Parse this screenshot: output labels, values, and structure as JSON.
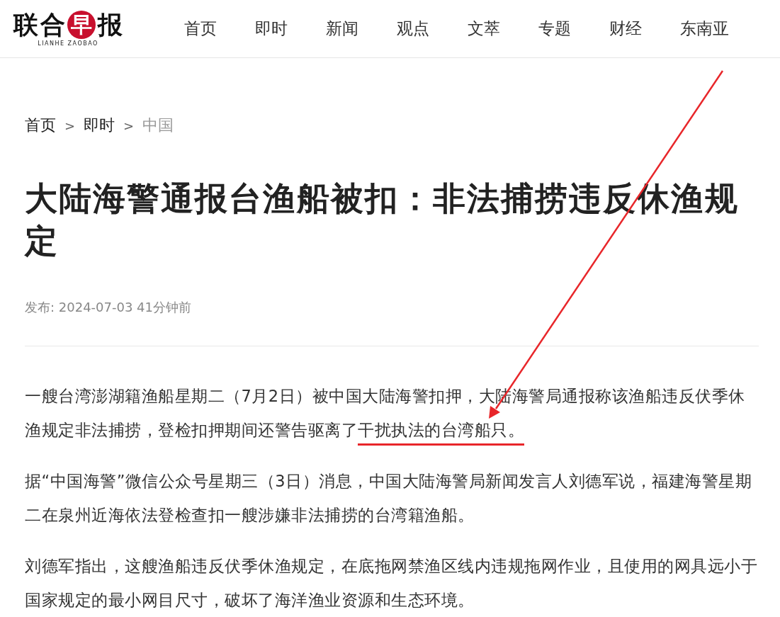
{
  "header": {
    "logo": {
      "chars": [
        {
          "text": "联",
          "kind": "plain"
        },
        {
          "text": "合",
          "kind": "plain"
        },
        {
          "text": "早",
          "kind": "circle"
        },
        {
          "text": "报",
          "kind": "plain"
        }
      ],
      "subtitle": "LIANHE ZAOBAO"
    },
    "nav": [
      {
        "label": "首页"
      },
      {
        "label": "即时"
      },
      {
        "label": "新闻"
      },
      {
        "label": "观点"
      },
      {
        "label": "文萃"
      },
      {
        "label": "专题"
      },
      {
        "label": "财经"
      },
      {
        "label": "东南亚"
      }
    ]
  },
  "breadcrumb": {
    "separator": ">",
    "items": [
      {
        "label": "首页",
        "current": false
      },
      {
        "label": "即时",
        "current": false
      },
      {
        "label": "中国",
        "current": true
      }
    ]
  },
  "article": {
    "title": "大陆海警通报台渔船被扣：非法捕捞违反休渔规定",
    "meta": "发布: 2024-07-03 41分钟前",
    "paragraphs": [
      [
        {
          "text": "一艘台湾澎湖籍渔船星期二（7月2日）被中国大陆海警扣押，大陆海警局通报称该渔船违反伏季休渔规定非法捕捞，登检扣押期间还警告驱离了",
          "marked": false
        },
        {
          "text": "干扰执法的台湾船只。",
          "marked": true
        }
      ],
      [
        {
          "text": "据“中国海警”微信公众号星期三（3日）消息，中国大陆海警局新闻发言人刘德军说，福建海警星期二在泉州近海依法登检查扣一艘涉嫌非法捕捞的台湾籍渔船。",
          "marked": false
        }
      ],
      [
        {
          "text": "刘德军指出，这艘渔船违反伏季休渔规定，在底拖网禁渔区线内违规拖网作业，且使用的网具远小于国家规定的最小网目尺寸，破坏了海洋渔业资源和生态环境。",
          "marked": false
        }
      ]
    ]
  },
  "annotations": [
    {
      "kind": "arrow"
    }
  ]
}
